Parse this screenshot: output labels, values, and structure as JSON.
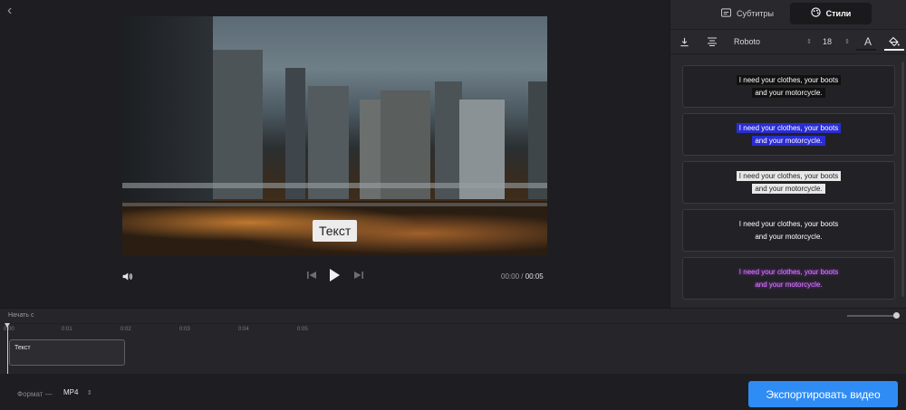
{
  "video": {
    "caption": "Текст"
  },
  "player": {
    "current_time": "00:00",
    "separator": "/",
    "total_time": "00:05"
  },
  "panel": {
    "tabs": [
      {
        "label": "Субтитры",
        "icon": "subtitles-icon"
      },
      {
        "label": "Стили",
        "icon": "palette-icon",
        "active": true
      }
    ],
    "toolbar": {
      "font": "Roboto",
      "size": "18",
      "text_color_glyph": "A"
    },
    "presets": [
      {
        "line1": "I need your clothes, your boots",
        "line2": "and your motorcycle.",
        "style": "black-box"
      },
      {
        "line1": "I need your clothes, your boots",
        "line2": "and your motorcycle.",
        "style": "blue-box"
      },
      {
        "line1": "I need your clothes, your boots",
        "line2": "and your motorcycle.",
        "style": "light-box"
      },
      {
        "line1": "I need your clothes, your boots",
        "line2": "and your motorcycle.",
        "style": "plain"
      },
      {
        "line1": "I need your clothes, your boots",
        "line2": "and your motorcycle.",
        "style": "glow-purple"
      }
    ]
  },
  "timeline": {
    "start_label": "Начать с",
    "ticks": [
      "0:00",
      "0:01",
      "0:02",
      "0:03",
      "0:04",
      "0:05"
    ],
    "clip_label": "Текст"
  },
  "footer": {
    "format_label": "Формат —",
    "format_value": "MP4",
    "export_label": "Экспортировать видео"
  },
  "colors": {
    "accent": "#2f8cf4",
    "background": "#1e1e22",
    "panel": "#28282d"
  }
}
